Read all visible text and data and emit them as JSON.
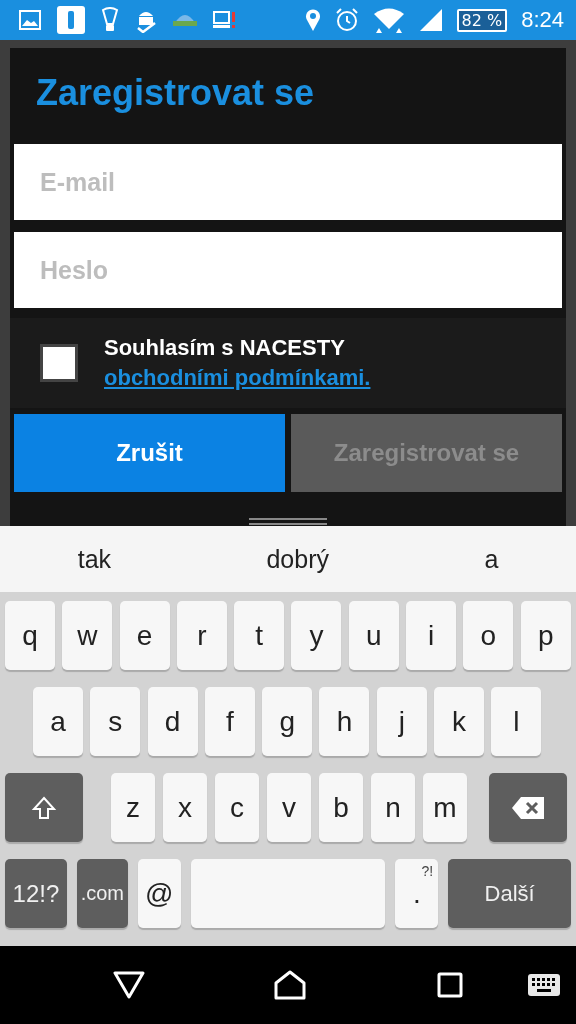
{
  "status_bar": {
    "battery": "82 %",
    "time": "8:24"
  },
  "dialog": {
    "title": "Zaregistrovat se",
    "fields": [
      {
        "placeholder": "E-mail"
      },
      {
        "placeholder": "Heslo"
      }
    ],
    "terms": {
      "checked": false,
      "text": "Souhlasím s NACESTY ",
      "link": "obchodními podmínkami."
    },
    "buttons": [
      {
        "label": "Zrušit",
        "disabled": false
      },
      {
        "label": "Zaregistrovat se",
        "disabled": true
      }
    ]
  },
  "suggestions": [
    "tak",
    "dobrý",
    "a"
  ],
  "keyboard": {
    "rows": [
      [
        {
          "kind": "letter",
          "label": "q"
        },
        {
          "kind": "letter",
          "label": "w"
        },
        {
          "kind": "letter",
          "label": "e"
        },
        {
          "kind": "letter",
          "label": "r"
        },
        {
          "kind": "letter",
          "label": "t"
        },
        {
          "kind": "letter",
          "label": "y"
        },
        {
          "kind": "letter",
          "label": "u"
        },
        {
          "kind": "letter",
          "label": "i"
        },
        {
          "kind": "letter",
          "label": "o"
        },
        {
          "kind": "letter",
          "label": "p"
        }
      ],
      [
        {
          "kind": "letter",
          "label": "a"
        },
        {
          "kind": "letter",
          "label": "s"
        },
        {
          "kind": "letter",
          "label": "d"
        },
        {
          "kind": "letter",
          "label": "f"
        },
        {
          "kind": "letter",
          "label": "g"
        },
        {
          "kind": "letter",
          "label": "h"
        },
        {
          "kind": "letter",
          "label": "j"
        },
        {
          "kind": "letter",
          "label": "k"
        },
        {
          "kind": "letter",
          "label": "l"
        }
      ],
      [
        {
          "kind": "shift"
        },
        {
          "kind": "letter",
          "label": "z"
        },
        {
          "kind": "letter",
          "label": "x"
        },
        {
          "kind": "letter",
          "label": "c"
        },
        {
          "kind": "letter",
          "label": "v"
        },
        {
          "kind": "letter",
          "label": "b"
        },
        {
          "kind": "letter",
          "label": "n"
        },
        {
          "kind": "letter",
          "label": "m"
        },
        {
          "kind": "backspace"
        }
      ]
    ],
    "bottom_row": [
      {
        "kind": "symbols",
        "label": "12!?"
      },
      {
        "kind": "com",
        "label": ".com"
      },
      {
        "kind": "at",
        "label": "@"
      },
      {
        "kind": "space"
      },
      {
        "kind": "period",
        "label": ".",
        "hint": "?!"
      },
      {
        "kind": "action",
        "label": "Další"
      }
    ]
  }
}
